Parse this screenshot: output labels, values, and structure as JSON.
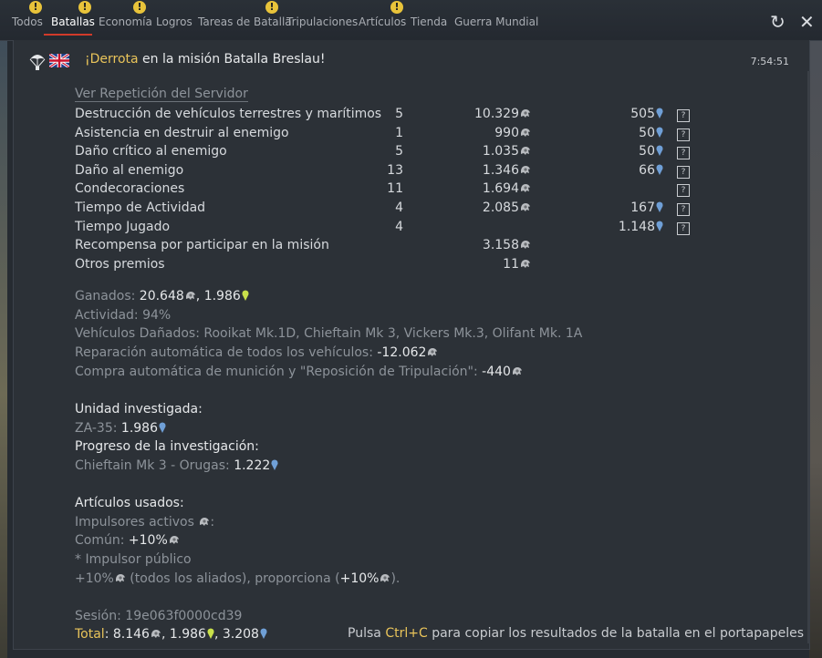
{
  "tabs": [
    {
      "label": "Todos",
      "alert": false
    },
    {
      "label": "Batallas",
      "alert": true,
      "active": true
    },
    {
      "label": "Economía",
      "alert": true
    },
    {
      "label": "Logros",
      "alert": true
    },
    {
      "label": "Tareas de Batalla",
      "alert": false
    },
    {
      "label": "Tripulaciones",
      "alert": true
    },
    {
      "label": "Artículos",
      "alert": false
    },
    {
      "label": "Tienda",
      "alert": true
    },
    {
      "label": "Guerra Mundial",
      "alert": false
    }
  ],
  "alert_glyph": "!",
  "controls": {
    "refresh": "↻",
    "close": "✕"
  },
  "header": {
    "defeat": "¡Derrota",
    "mission": " en la misión Batalla Breslau!",
    "time": "7:54:51"
  },
  "replay_link": "Ver Repetición del Servidor",
  "help_glyph": "?",
  "rows": [
    {
      "name": "Destrucción de vehículos terrestres y marítimos",
      "count": "5",
      "sl": "10.329",
      "rp": "505",
      "help": true
    },
    {
      "name": "Asistencia en destruir al enemigo",
      "count": "1",
      "sl": "990",
      "rp": "50",
      "help": true
    },
    {
      "name": "Daño crítico al enemigo",
      "count": "5",
      "sl": "1.035",
      "rp": "50",
      "help": true
    },
    {
      "name": "Daño al enemigo",
      "count": "13",
      "sl": "1.346",
      "rp": "66",
      "help": true
    },
    {
      "name": "Condecoraciones",
      "count": "11",
      "sl": "1.694",
      "rp": "",
      "help": true
    },
    {
      "name": "Tiempo de Actividad",
      "count": "4",
      "sl": "2.085",
      "rp": "167",
      "help": true
    },
    {
      "name": "Tiempo Jugado",
      "count": "4",
      "sl": "",
      "rp": "1.148",
      "help": true
    },
    {
      "name": "Recompensa por participar en la misión",
      "count": "",
      "sl": "3.158",
      "rp": "",
      "help": false
    },
    {
      "name": "Otros premios",
      "count": "",
      "sl": "11",
      "rp": "",
      "help": false
    }
  ],
  "summary": {
    "earned_label": "Ganados: ",
    "earned_sl": "20.648",
    "sep": ", ",
    "earned_gold": "1.986",
    "activity": "Actividad: 94%",
    "damaged": "Vehículos Dañados: Rooikat Mk.1D, Chieftain Mk 3, Vickers Mk.3, Olifant Mk. 1A",
    "repair_label": "Reparación automática de todos los vehículos: ",
    "repair_value": "-12.062",
    "ammo_label": "Compra automática de munición y \"Reposición de Tripulación\": ",
    "ammo_value": "-440"
  },
  "research": {
    "unit_title": "Unidad investigada:",
    "unit_name": "ZA-35: ",
    "unit_value": "1.986",
    "progress_title": "Progreso de la investigación:",
    "progress_name": "Chieftain Mk 3 - Orugas: ",
    "progress_value": "1.222"
  },
  "items": {
    "title": "Artículos usados:",
    "boosters": "Impulsores activos ",
    "colon": ":",
    "common_label": "Común: ",
    "common_value": "+10%",
    "public": "* Impulsor público",
    "ally_value": "+10%",
    "ally_text": " (todos los aliados), proporciona (",
    "ally_value2": "+10%",
    "ally_close": ")."
  },
  "session": "Sesión: 19e063f0000cd39",
  "total": {
    "label": "Total",
    "colon": ": ",
    "sl": "8.146",
    "sep1": ", ",
    "gold": "1.986",
    "sep2": ", ",
    "rp": "3.208"
  },
  "footer": {
    "pre": "Pulsa ",
    "key": "Ctrl+C",
    "post": " para copiar los resultados de la batalla en el portapapeles"
  },
  "colors": {
    "accent_red": "#d03a2a",
    "alert_yellow": "#e8c33a",
    "rp_blue": "#6f9fd6",
    "gold_yellow": "#c8e04a"
  }
}
